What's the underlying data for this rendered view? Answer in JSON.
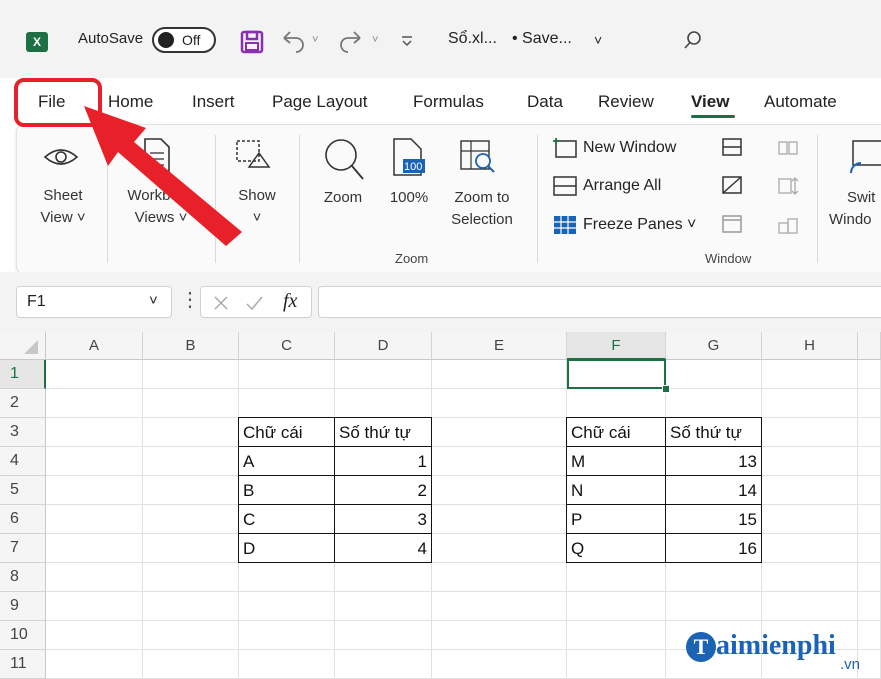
{
  "titlebar": {
    "autosave_label": "AutoSave",
    "autosave_state": "Off",
    "filename": "Sổ.xl...",
    "saved_status": "• Save..."
  },
  "menu": [
    "File",
    "Home",
    "Insert",
    "Page Layout",
    "Formulas",
    "Data",
    "Review",
    "View",
    "Automate"
  ],
  "ribbon": {
    "sheet_view": [
      "Sheet",
      "View ˅"
    ],
    "workbook_views": [
      "Workbook",
      "Views ˅"
    ],
    "show": [
      "Show",
      "˅"
    ],
    "zoom": "Zoom",
    "zoom_100": "100%",
    "zoom_selection": [
      "Zoom to",
      "Selection"
    ],
    "new_window": "New Window",
    "arrange_all": "Arrange All",
    "freeze_panes": "Freeze Panes ˅",
    "switch_windows": [
      "Swit",
      "Windo"
    ],
    "group_zoom": "Zoom",
    "group_window": "Window"
  },
  "formula_bar": {
    "name_box": "F1",
    "fx": "fx",
    "value": ""
  },
  "columns": [
    "A",
    "B",
    "C",
    "D",
    "E",
    "F",
    "G",
    "H"
  ],
  "rows": [
    "1",
    "2",
    "3",
    "4",
    "5",
    "6",
    "7",
    "8",
    "9",
    "10",
    "11"
  ],
  "table1": {
    "headers": [
      "Chữ cái",
      "Số thứ tự"
    ],
    "rows": [
      [
        "A",
        "1"
      ],
      [
        "B",
        "2"
      ],
      [
        "C",
        "3"
      ],
      [
        "D",
        "4"
      ]
    ]
  },
  "table2": {
    "headers": [
      "Chữ cái",
      "Số thứ tự"
    ],
    "rows": [
      [
        "M",
        "13"
      ],
      [
        "N",
        "14"
      ],
      [
        "P",
        "15"
      ],
      [
        "Q",
        "16"
      ]
    ]
  },
  "watermark": {
    "brand": "aimienphi",
    "tld": ".vn"
  },
  "colors": {
    "excel_green": "#1d7044",
    "annotation_red": "#e8202a",
    "save_purple": "#8a2fb0",
    "watermark_blue": "#1b63b5"
  }
}
